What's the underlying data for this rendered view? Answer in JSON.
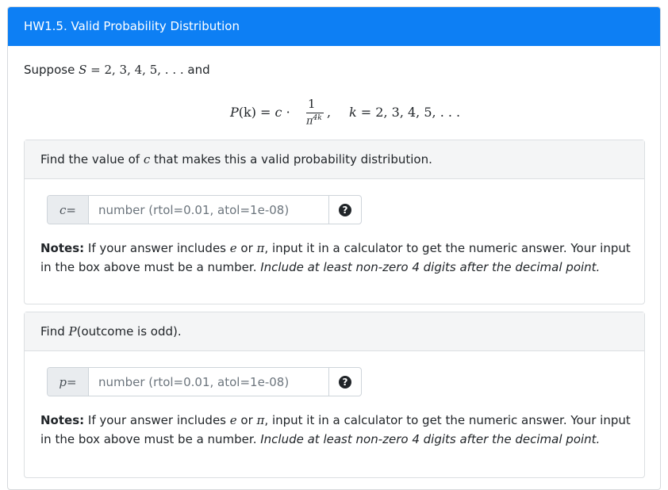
{
  "header": {
    "title": "HW1.5. Valid Probability Distribution"
  },
  "intro": {
    "prefix": "Suppose",
    "S": "S",
    "eq": " = 2, 3, 4, 5, . . .",
    "suffix": "and"
  },
  "formula": {
    "lhs": "P",
    "lhs_arg": "(k) = ",
    "c": "c",
    "dot": " · ",
    "numerator": "1",
    "pi": "π",
    "exp": "4k",
    "comma": ",",
    "range_k": "k",
    "range": " = 2, 3, 4, 5, . . ."
  },
  "questions": [
    {
      "prompt_prefix": "Find the value of ",
      "prompt_var": "c",
      "prompt_suffix": " that makes this a valid probability distribution.",
      "var_label": "c",
      "eq": " =",
      "placeholder": "number (rtol=0.01, atol=1e-08)",
      "value": "",
      "help": "?",
      "notes_label": "Notes:",
      "notes_text1": " If your answer includes ",
      "notes_e": "e",
      "notes_or": " or ",
      "notes_pi": "π",
      "notes_text2": ", input it in a calculator to get the numeric answer. Your input in the box above must be a number. ",
      "notes_italic": "Include at least non-zero 4 digits after the decimal point."
    },
    {
      "prompt_prefix": "Find ",
      "prompt_var": "P",
      "prompt_suffix": "(outcome is odd).",
      "var_label": "p",
      "eq": " =",
      "placeholder": "number (rtol=0.01, atol=1e-08)",
      "value": "",
      "help": "?",
      "notes_label": "Notes:",
      "notes_text1": " If your answer includes ",
      "notes_e": "e",
      "notes_or": " or ",
      "notes_pi": "π",
      "notes_text2": ", input it in a calculator to get the numeric answer. Your input in the box above must be a number. ",
      "notes_italic": "Include at least non-zero 4 digits after the decimal point."
    }
  ]
}
